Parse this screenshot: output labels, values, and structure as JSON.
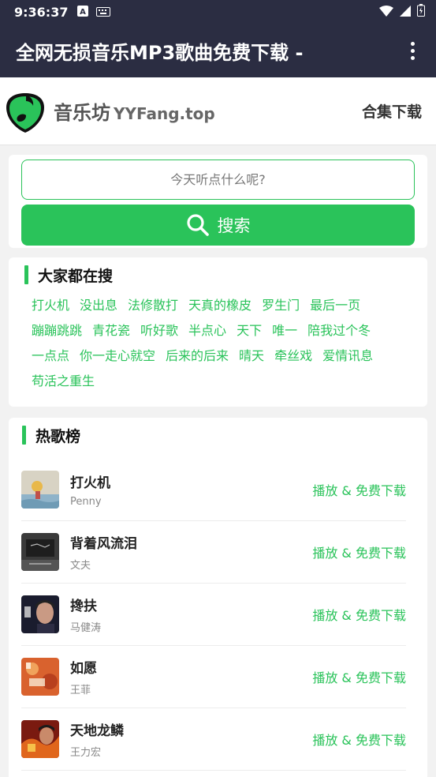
{
  "status_bar": {
    "time": "9:36:37"
  },
  "app_bar": {
    "title": "全网无损音乐MP3歌曲免费下载 -"
  },
  "header": {
    "brand": "音乐坊",
    "domain": "YYFang.top",
    "collection_link": "合集下载"
  },
  "search": {
    "placeholder": "今天听点什么呢?",
    "button_label": "搜索"
  },
  "trending": {
    "title": "大家都在搜",
    "tags": [
      "打火机",
      "没出息",
      "法修散打",
      "天真的橡皮",
      "罗生门",
      "最后一页",
      "蹦蹦跳跳",
      "青花瓷",
      "听好歌",
      "半点心",
      "天下",
      "唯一",
      "陪我过个冬",
      "一点点",
      "你一走心就空",
      "后来的后来",
      "晴天",
      "牵丝戏",
      "爱情讯息",
      "苟活之重生"
    ]
  },
  "hot": {
    "title": "热歌榜",
    "action_label": "播放 & 免费下载",
    "songs": [
      {
        "title": "打火机",
        "artist": "Penny"
      },
      {
        "title": "背着风流泪",
        "artist": "文夫"
      },
      {
        "title": "搀扶",
        "artist": "马健涛"
      },
      {
        "title": "如愿",
        "artist": "王菲"
      },
      {
        "title": "天地龙鳞",
        "artist": "王力宏"
      }
    ]
  },
  "colors": {
    "accent": "#2ac35a",
    "app_bar": "#2b2d42"
  }
}
